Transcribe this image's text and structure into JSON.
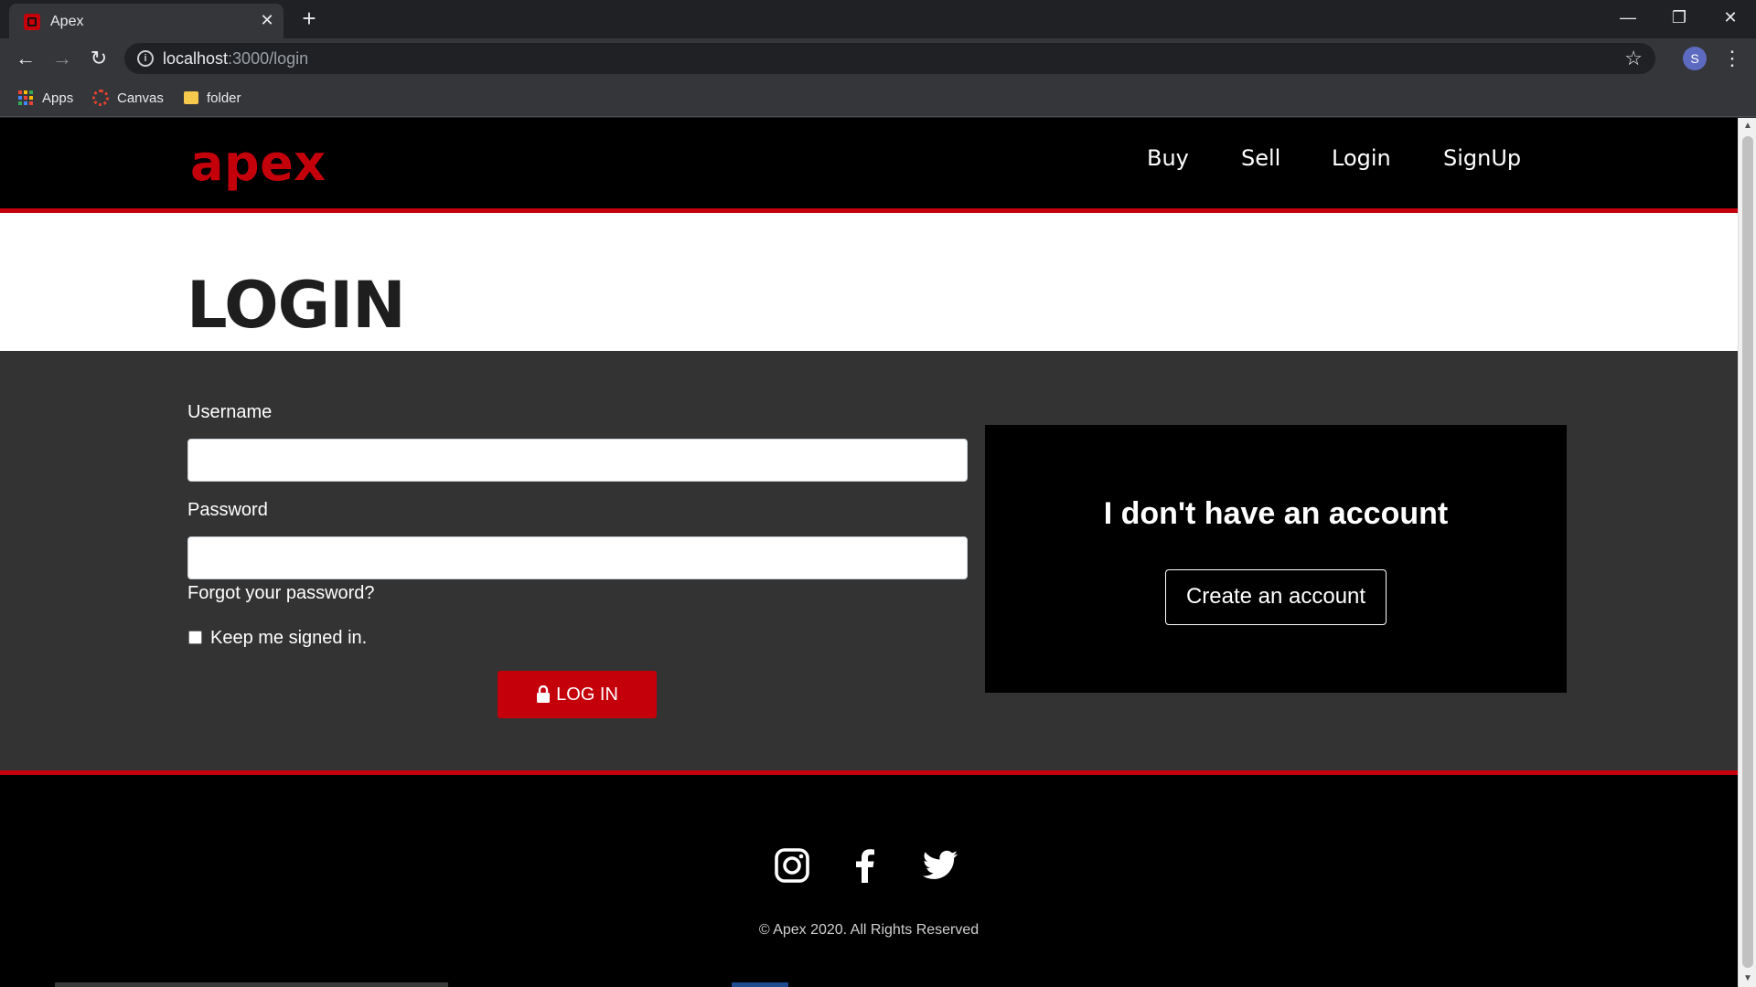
{
  "browser": {
    "tab_title": "Apex",
    "tab_close": "✕",
    "new_tab": "+",
    "url_host": "localhost",
    "url_path": ":3000/login",
    "profile_initial": "S",
    "bookmarks": [
      {
        "label": "Apps",
        "icon": "apps-grid-icon"
      },
      {
        "label": "Canvas",
        "icon": "canvas-icon"
      },
      {
        "label": "folder",
        "icon": "folder-icon"
      }
    ]
  },
  "site": {
    "logo": "apex",
    "nav": [
      "Buy",
      "Sell",
      "Login",
      "SignUp"
    ],
    "page_title": "LOGIN"
  },
  "form": {
    "username_label": "Username",
    "username_value": "",
    "password_label": "Password",
    "password_value": "",
    "forgot_link": "Forgot your password?",
    "keep_signed_in": "Keep me signed in.",
    "keep_checked": false,
    "login_button": "LOG IN"
  },
  "signup_panel": {
    "heading": "I don't have an account",
    "button": "Create an account"
  },
  "footer": {
    "social": [
      "instagram-icon",
      "facebook-icon",
      "twitter-icon"
    ],
    "copyright": "© Apex 2020. All Rights Reserved"
  },
  "colors": {
    "brand_red": "#c4000b",
    "header_bg": "#000000",
    "content_bg": "#333333"
  }
}
